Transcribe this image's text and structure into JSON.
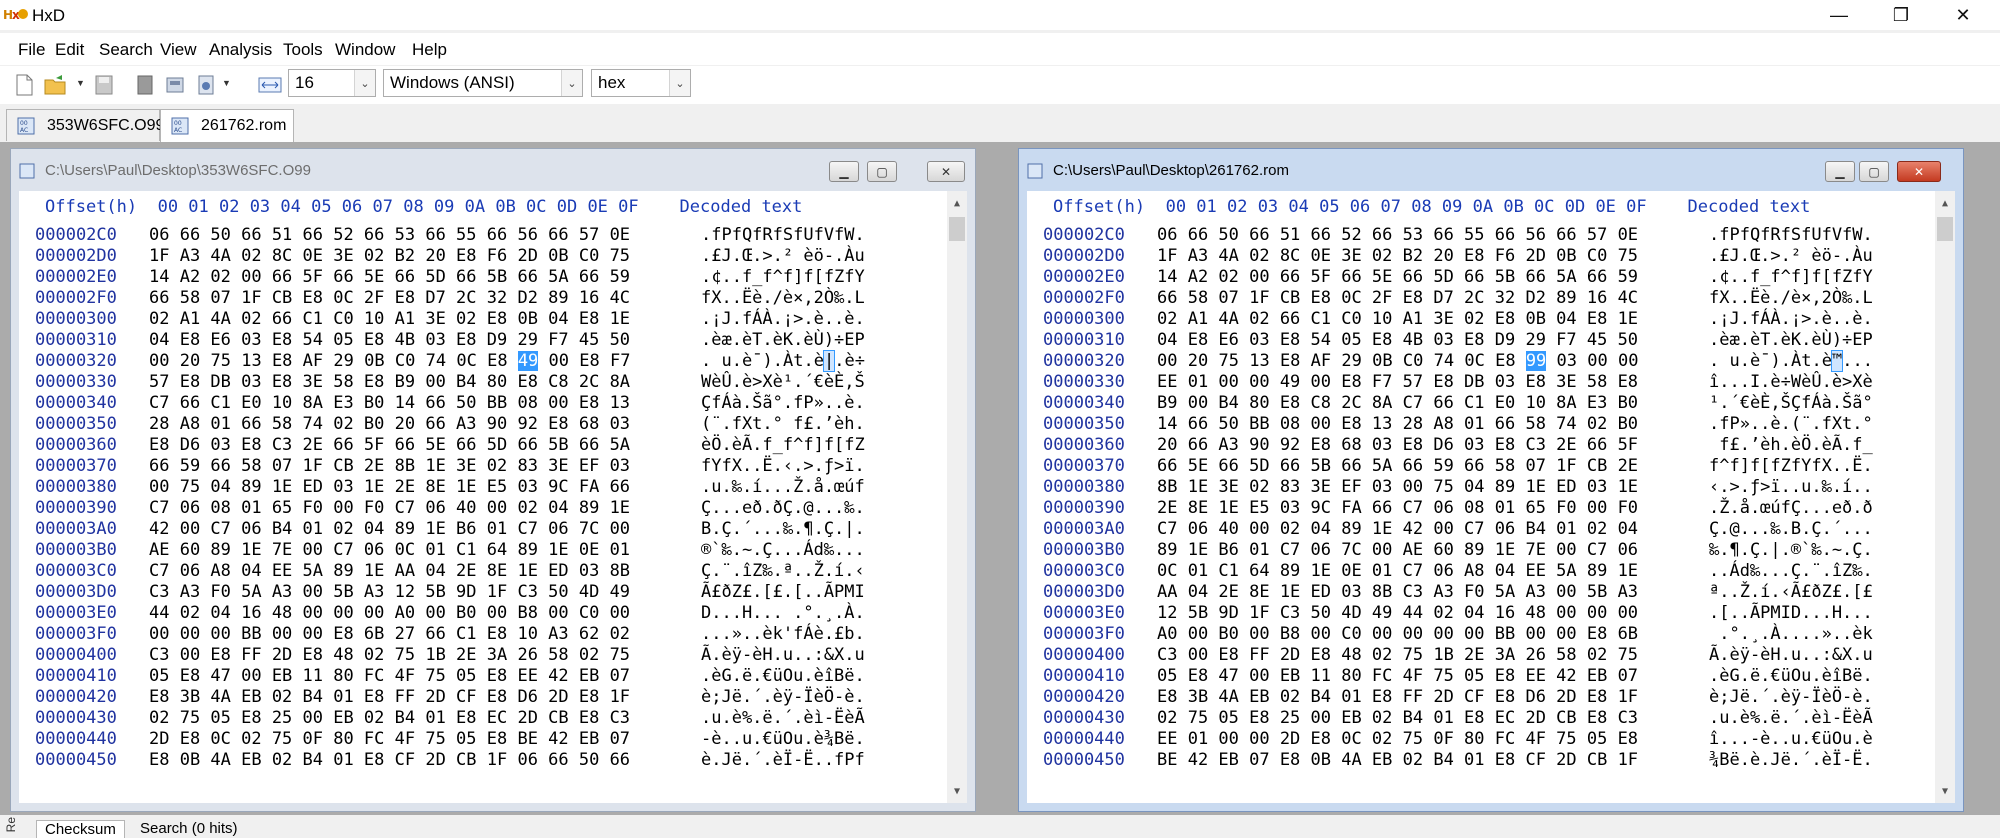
{
  "app": {
    "title": "HxD"
  },
  "menu": [
    "File",
    "Edit",
    "Search",
    "View",
    "Analysis",
    "Tools",
    "Window",
    "Help"
  ],
  "toolbar": {
    "bytes_per_row": "16",
    "charset": "Windows (ANSI)",
    "offset_base": "hex"
  },
  "tabs": [
    "353W6SFC.O99",
    "261762.rom"
  ],
  "left_window": {
    "title": "C:\\Users\\Paul\\Desktop\\353W6SFC.O99",
    "header": "Offset(h)  00 01 02 03 04 05 06 07 08 09 0A 0B 0C 0D 0E 0F    Decoded text",
    "selected": {
      "row": 6,
      "byte": 12
    },
    "rows": [
      {
        "offset": "000002C0",
        "hex": "06 66 50 66 51 66 52 66 53 66 55 66 56 66 57 0E",
        "text": ".fPfQfRfSfUfVfW."
      },
      {
        "offset": "000002D0",
        "hex": "1F A3 4A 02 8C 0E 3E 02 B2 20 E8 F6 2D 0B C0 75",
        "text": ".£J.Œ.>.² èö-.Àu"
      },
      {
        "offset": "000002E0",
        "hex": "14 A2 02 00 66 5F 66 5E 66 5D 66 5B 66 5A 66 59",
        "text": ".¢..f_f^f]f[fZfY"
      },
      {
        "offset": "000002F0",
        "hex": "66 58 07 1F CB E8 0C 2F E8 D7 2C 32 D2 89 16 4C",
        "text": "fX..Ëè./è×,2Ò‰.L"
      },
      {
        "offset": "00000300",
        "hex": "02 A1 4A 02 66 C1 C0 10 A1 3E 02 E8 0B 04 E8 1E",
        ".text": "",
        "text": ".¡J.fÁÀ.¡>.è..è."
      },
      {
        "offset": "00000310",
        "hex": "04 E8 E6 03 E8 54 05 E8 4B 03 E8 D9 29 F7 45 50",
        "text": ".èæ.èT.èK.èÙ)÷EP"
      },
      {
        "offset": "00000320",
        "hex": "00 20 75 13 E8 AF 29 0B C0 74 0C E8 49 00 E8 F7",
        "text": ". u.è¯).Àt.è|.è÷"
      },
      {
        "offset": "00000330",
        "hex": "57 E8 DB 03 E8 3E 58 E8 B9 00 B4 80 E8 C8 2C 8A",
        "text": "WèÛ.è>Xè¹.´€èÈ,Š"
      },
      {
        "offset": "00000340",
        "hex": "C7 66 C1 E0 10 8A E3 B0 14 66 50 BB 08 00 E8 13",
        "text": "ÇfÁà.Šã°.fP»..è."
      },
      {
        "offset": "00000350",
        "hex": "28 A8 01 66 58 74 02 B0 20 66 A3 90 92 E8 68 03",
        "text": "(¨.fXt.° f£.’èh."
      },
      {
        "offset": "00000360",
        "hex": "E8 D6 03 E8 C3 2E 66 5F 66 5E 66 5D 66 5B 66 5A",
        "text": "èÖ.èÃ.f_f^f]f[fZ"
      },
      {
        "offset": "00000370",
        "hex": "66 59 66 58 07 1F CB 2E 8B 1E 3E 02 83 3E EF 03",
        "text": "fYfX..Ë.‹.>.ƒ>ï."
      },
      {
        "offset": "00000380",
        "hex": "00 75 04 89 1E ED 03 1E 2E 8E 1E E5 03 9C FA 66",
        "text": ".u.‰.í...Ž.å.œúf"
      },
      {
        "offset": "00000390",
        "hex": "C7 06 08 01 65 F0 00 F0 C7 06 40 00 02 04 89 1E",
        "text": "Ç...eð.ðÇ.@...‰."
      },
      {
        "offset": "000003A0",
        "hex": "42 00 C7 06 B4 01 02 04 89 1E B6 01 C7 06 7C 00",
        "text": "B.Ç.´...‰.¶.Ç.|."
      },
      {
        "offset": "000003B0",
        "hex": "AE 60 89 1E 7E 00 C7 06 0C 01 C1 64 89 1E 0E 01",
        "text": "®`‰.~.Ç...Ád‰..."
      },
      {
        "offset": "000003C0",
        "hex": "C7 06 A8 04 EE 5A 89 1E AA 04 2E 8E 1E ED 03 8B",
        "text": "Ç.¨.îZ‰.ª..Ž.í.‹"
      },
      {
        "offset": "000003D0",
        "hex": "C3 A3 F0 5A A3 00 5B A3 12 5B 9D 1F C3 50 4D 49",
        "text": "Ã£ðZ£.[£.[..ÃPMI"
      },
      {
        "offset": "000003E0",
        "hex": "44 02 04 16 48 00 00 00 A0 00 B0 00 B8 00 C0 00",
        "text": "D...H... .°.¸.À."
      },
      {
        "offset": "000003F0",
        "hex": "00 00 00 BB 00 00 E8 6B 27 66 C1 E8 10 A3 62 02",
        "text": "...»..èk'fÁè.£b."
      },
      {
        "offset": "00000400",
        "hex": "C3 00 E8 FF 2D E8 48 02 75 1B 2E 3A 26 58 02 75",
        "text": "Ã.èÿ-èH.u..:&X.u"
      },
      {
        "offset": "00000410",
        "hex": "05 E8 47 00 EB 11 80 FC 4F 75 05 E8 EE 42 EB 07",
        "text": ".èG.ë.€üOu.èîBë."
      },
      {
        "offset": "00000420",
        "hex": "E8 3B 4A EB 02 B4 01 E8 FF 2D CF E8 D6 2D E8 1F",
        "text": "è;Jë.´.èÿ-ÏèÖ-è."
      },
      {
        "offset": "00000430",
        "hex": "02 75 05 E8 25 00 EB 02 B4 01 E8 EC 2D CB E8 C3",
        "text": ".u.è%.ë.´.èì-ËèÃ"
      },
      {
        "offset": "00000440",
        "hex": "2D E8 0C 02 75 0F 80 FC 4F 75 05 E8 BE 42 EB 07",
        "text": "-è..u.€üOu.è¾Bë."
      },
      {
        "offset": "00000450",
        "hex": "E8 0B 4A EB 02 B4 01 E8 CF 2D CB 1F 06 66 50 66",
        "text": "è.Jë.´.èÏ-Ë..fPf"
      }
    ]
  },
  "right_window": {
    "title": "C:\\Users\\Paul\\Desktop\\261762.rom",
    "header": "Offset(h)  00 01 02 03 04 05 06 07 08 09 0A 0B 0C 0D 0E 0F    Decoded text",
    "selected": {
      "row": 6,
      "byte": 12
    },
    "rows": [
      {
        "offset": "000002C0",
        "hex": "06 66 50 66 51 66 52 66 53 66 55 66 56 66 57 0E",
        "text": ".fPfQfRfSfUfVfW."
      },
      {
        "offset": "000002D0",
        "hex": "1F A3 4A 02 8C 0E 3E 02 B2 20 E8 F6 2D 0B C0 75",
        "text": ".£J.Œ.>.² èö-.Àu"
      },
      {
        "offset": "000002E0",
        "hex": "14 A2 02 00 66 5F 66 5E 66 5D 66 5B 66 5A 66 59",
        "text": ".¢..f_f^f]f[fZfY"
      },
      {
        "offset": "000002F0",
        "hex": "66 58 07 1F CB E8 0C 2F E8 D7 2C 32 D2 89 16 4C",
        "text": "fX..Ëè./è×,2Ò‰.L"
      },
      {
        "offset": "00000300",
        "hex": "02 A1 4A 02 66 C1 C0 10 A1 3E 02 E8 0B 04 E8 1E",
        "text": ".¡J.fÁÀ.¡>.è..è."
      },
      {
        "offset": "00000310",
        "hex": "04 E8 E6 03 E8 54 05 E8 4B 03 E8 D9 29 F7 45 50",
        "text": ".èæ.èT.èK.èÙ)÷EP"
      },
      {
        "offset": "00000320",
        "hex": "00 20 75 13 E8 AF 29 0B C0 74 0C E8 99 03 00 00",
        "text": ". u.è¯).Àt.è™..."
      },
      {
        "offset": "00000330",
        "hex": "EE 01 00 00 49 00 E8 F7 57 E8 DB 03 E8 3E 58 E8",
        "text": "î...I.è÷WèÛ.è>Xè"
      },
      {
        "offset": "00000340",
        "hex": "B9 00 B4 80 E8 C8 2C 8A C7 66 C1 E0 10 8A E3 B0",
        "text": "¹.´€èÈ,ŠÇfÁà.Šã°"
      },
      {
        "offset": "00000350",
        "hex": "14 66 50 BB 08 00 E8 13 28 A8 01 66 58 74 02 B0",
        "text": ".fP»..è.(¨.fXt.°"
      },
      {
        "offset": "00000360",
        "hex": "20 66 A3 90 92 E8 68 03 E8 D6 03 E8 C3 2E 66 5F",
        "text": " f£.’èh.èÖ.èÃ.f_"
      },
      {
        "offset": "00000370",
        "hex": "66 5E 66 5D 66 5B 66 5A 66 59 66 58 07 1F CB 2E",
        "text": "f^f]f[fZfYfX..Ë."
      },
      {
        "offset": "00000380",
        "hex": "8B 1E 3E 02 83 3E EF 03 00 75 04 89 1E ED 03 1E",
        "text": "‹.>.ƒ>ï..u.‰.í.."
      },
      {
        "offset": "00000390",
        "hex": "2E 8E 1E E5 03 9C FA 66 C7 06 08 01 65 F0 00 F0",
        "text": ".Ž.å.œúfÇ...eð.ð"
      },
      {
        "offset": "000003A0",
        "hex": "C7 06 40 00 02 04 89 1E 42 00 C7 06 B4 01 02 04",
        "text": "Ç.@...‰.B.Ç.´..."
      },
      {
        "offset": "000003B0",
        "hex": "89 1E B6 01 C7 06 7C 00 AE 60 89 1E 7E 00 C7 06",
        "text": "‰.¶.Ç.|.®`‰.~.Ç."
      },
      {
        "offset": "000003C0",
        "hex": "0C 01 C1 64 89 1E 0E 01 C7 06 A8 04 EE 5A 89 1E",
        "text": "..Ád‰...Ç.¨.îZ‰."
      },
      {
        "offset": "000003D0",
        "hex": "AA 04 2E 8E 1E ED 03 8B C3 A3 F0 5A A3 00 5B A3",
        "text": "ª..Ž.í.‹Ã£ðZ£.[£"
      },
      {
        "offset": "000003E0",
        "hex": "12 5B 9D 1F C3 50 4D 49 44 02 04 16 48 00 00 00",
        "text": ".[..ÃPMID...H..."
      },
      {
        "offset": "000003F0",
        "hex": "A0 00 B0 00 B8 00 C0 00 00 00 00 BB 00 00 E8 6B",
        "text": " .°.¸.À....»..èk"
      },
      {
        "offset": "00000400",
        "hex": "C3 00 E8 FF 2D E8 48 02 75 1B 2E 3A 26 58 02 75",
        "text": "Ã.èÿ-èH.u..:&X.u"
      },
      {
        "offset": "00000410",
        "hex": "05 E8 47 00 EB 11 80 FC 4F 75 05 E8 EE 42 EB 07",
        "text": ".èG.ë.€üOu.èîBë."
      },
      {
        "offset": "00000420",
        "hex": "E8 3B 4A EB 02 B4 01 E8 FF 2D CF E8 D6 2D E8 1F",
        "text": "è;Jë.´.èÿ-ÏèÖ-è."
      },
      {
        "offset": "00000430",
        "hex": "02 75 05 E8 25 00 EB 02 B4 01 E8 EC 2D CB E8 C3",
        "text": ".u.è%.ë.´.èì-ËèÃ"
      },
      {
        "offset": "00000440",
        "hex": "EE 01 00 00 2D E8 0C 02 75 0F 80 FC 4F 75 05 E8",
        "text": "î...-è..u.€üOu.è"
      },
      {
        "offset": "00000450",
        "hex": "BE 42 EB 07 E8 0B 4A EB 02 B4 01 E8 CF 2D CB 1F",
        "text": "¾Bë.è.Jë.´.èÏ-Ë."
      }
    ]
  },
  "bottom_tabs": [
    "Checksum",
    "Search (0 hits)"
  ],
  "colors": {
    "offset_blue": "#2033a0",
    "selection": "#3399ff",
    "active_title": "#c9daf0",
    "inactive_title": "#dde3ec"
  }
}
